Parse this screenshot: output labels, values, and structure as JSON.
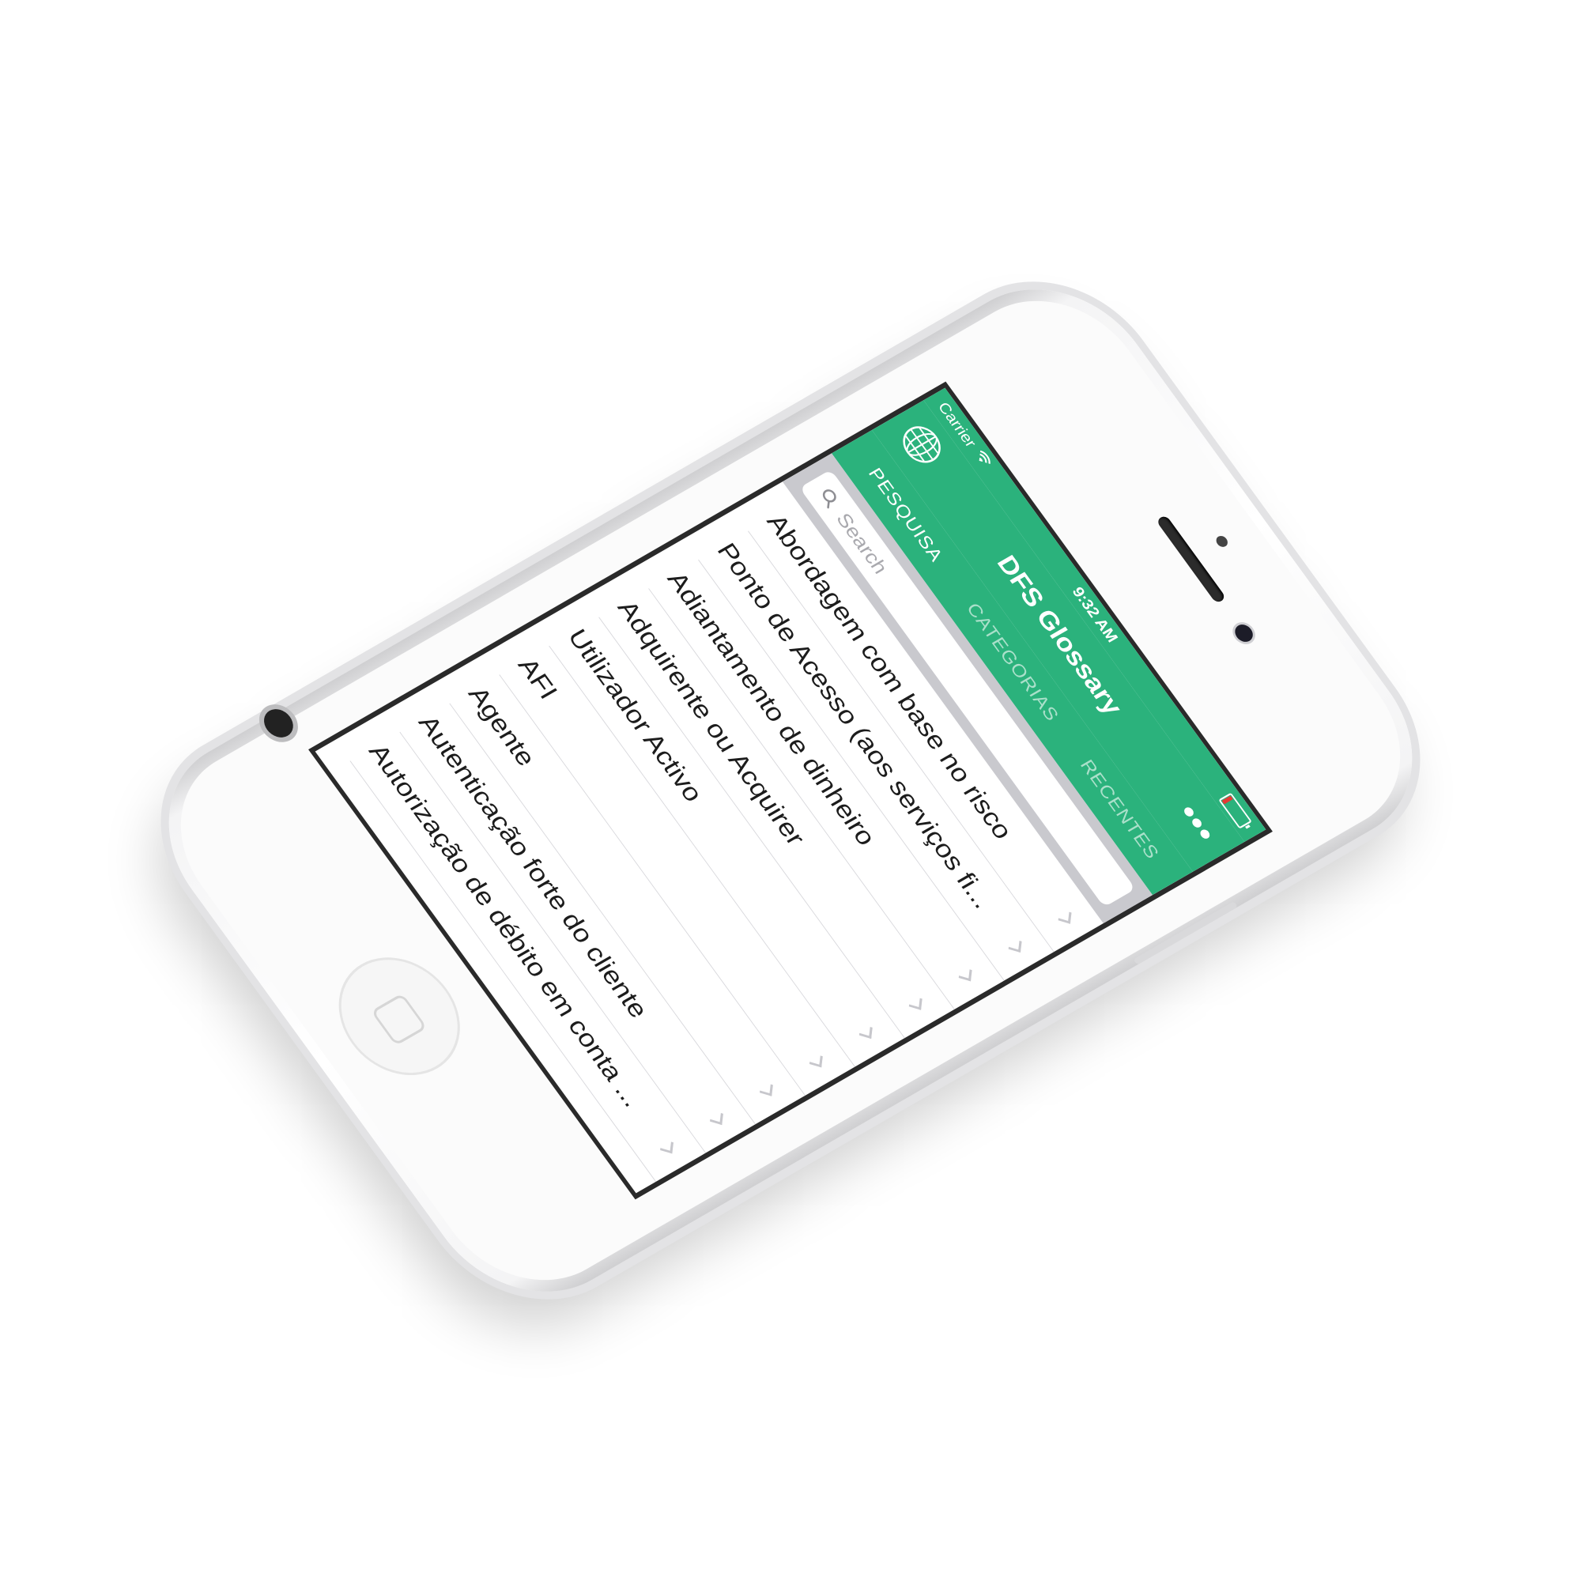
{
  "status_bar": {
    "carrier": "Carrier",
    "time": "9:32 AM",
    "battery_level": 0.12,
    "battery_color": "#e53935"
  },
  "nav": {
    "title": "DFS Glossary",
    "more_label": "•••",
    "accent_color": "#2bb27c",
    "globe_icon": "globe-icon"
  },
  "tabs": [
    {
      "label": "PESQUISA",
      "active": true
    },
    {
      "label": "CATEGORIAS",
      "active": false
    },
    {
      "label": "RECENTES",
      "active": false
    }
  ],
  "search": {
    "placeholder": "Search",
    "value": ""
  },
  "list": {
    "items": [
      {
        "label": "Abordagem com base no risco"
      },
      {
        "label": "Ponto de Acesso (aos serviços fi..."
      },
      {
        "label": "Adiantamento de dinheiro"
      },
      {
        "label": "Adquirente ou Acquirer"
      },
      {
        "label": "Utilizador Activo"
      },
      {
        "label": "AFI"
      },
      {
        "label": "Agente"
      },
      {
        "label": "Autenticação forte do cliente"
      },
      {
        "label": "Autorização de débito em conta ..."
      }
    ]
  }
}
